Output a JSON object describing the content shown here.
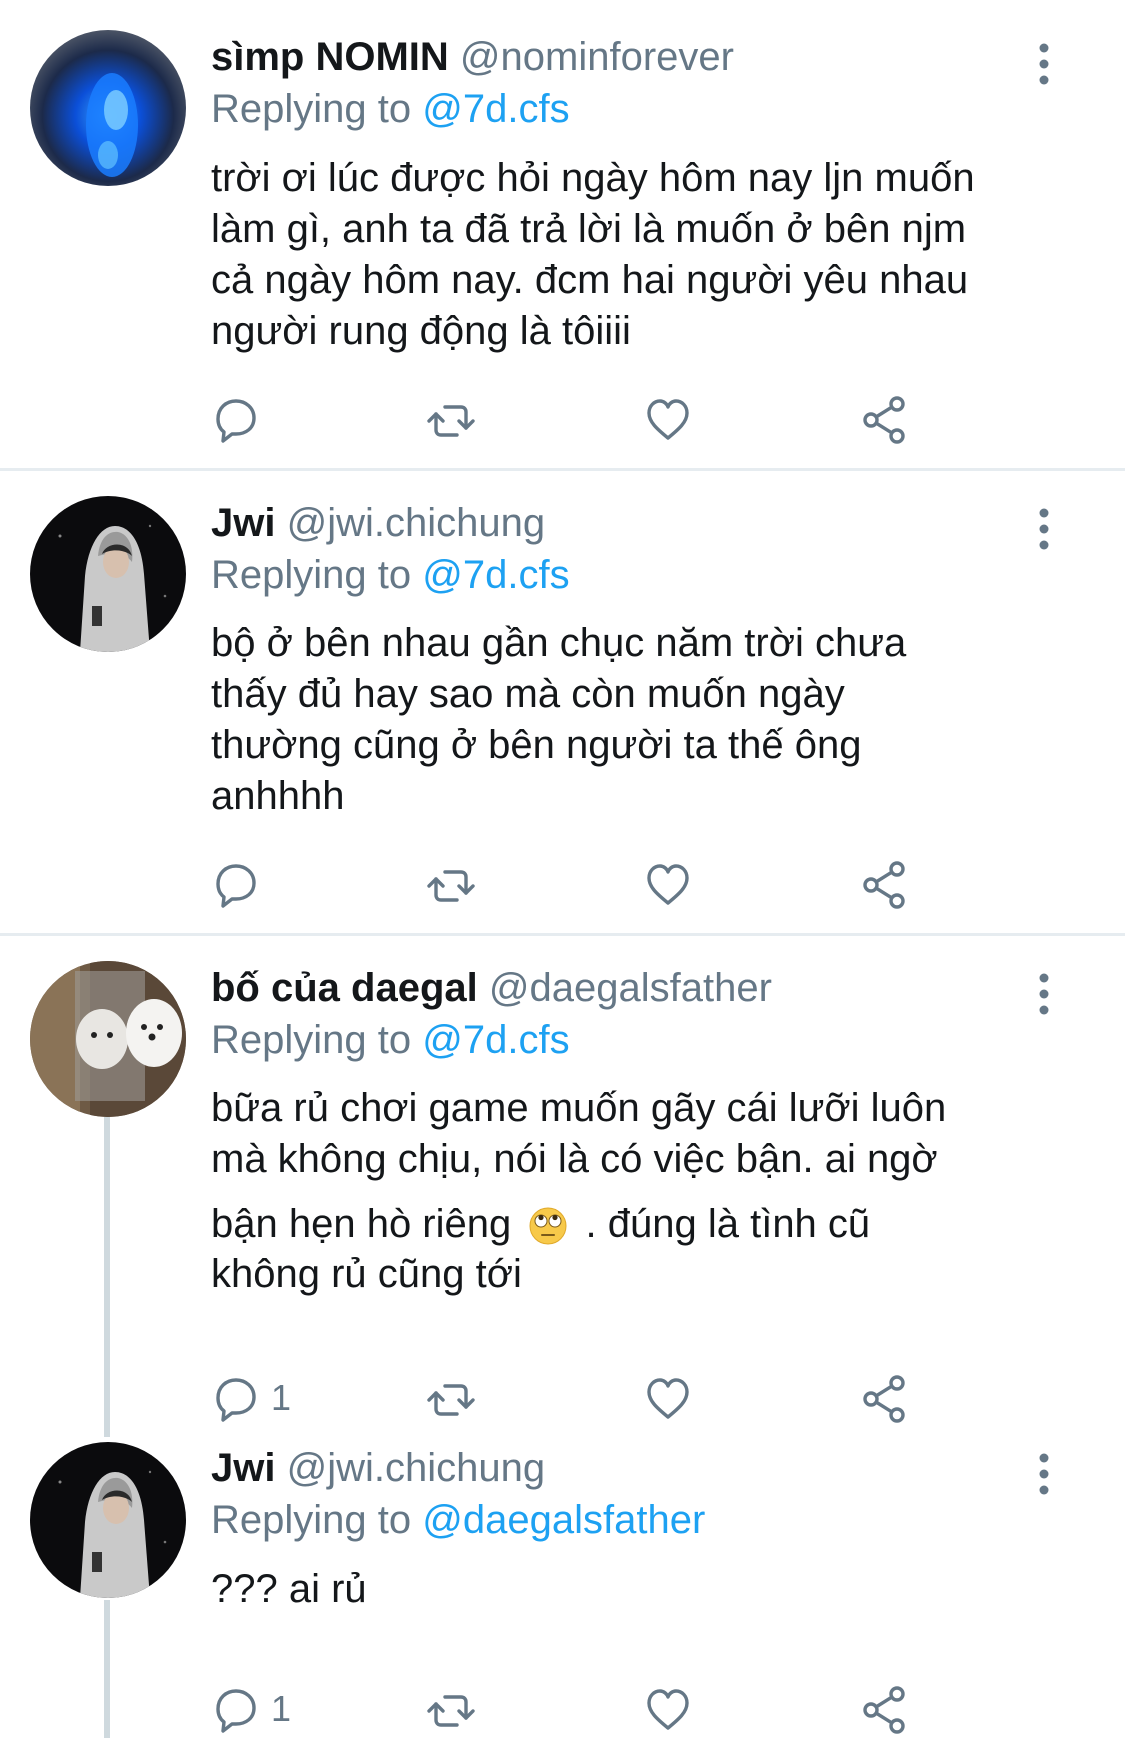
{
  "tweets": [
    {
      "name": "sìmp NOMIN",
      "handle": "@nominforever",
      "replying_prefix": "Replying to",
      "replying_to": "@7d.cfs",
      "lines": [
        "trời ơi lúc được hỏi ngày hôm nay ljn muốn",
        "làm gì, anh ta đã trả lời là muốn ở bên njm",
        "cả ngày hôm nay. đcm hai người yêu nhau",
        "người rung động là tôiiii"
      ],
      "reply_count": ""
    },
    {
      "name": "Jwi",
      "handle": "@jwi.chichung",
      "replying_prefix": "Replying to",
      "replying_to": "@7d.cfs",
      "lines": [
        "bộ ở bên nhau gần chục năm trời chưa",
        "thấy đủ hay sao mà còn muốn ngày",
        "thường cũng ở bên người ta thế ông",
        "anhhhh"
      ],
      "reply_count": ""
    },
    {
      "name": "bố của daegal",
      "handle": "@daegalsfather",
      "replying_prefix": "Replying to",
      "replying_to": "@7d.cfs",
      "lines": [
        "bữa rủ chơi game muốn gãy cái lưỡi luôn",
        "mà không chịu, nói là có việc bận. ai ngờ"
      ],
      "line3_before_emoji": "bận hẹn hò riêng",
      "line3_after_emoji": ". đúng là tình cũ",
      "line4": "không rủ cũng tới",
      "emoji": "face-with-rolling-eyes-emoji",
      "reply_count": "1"
    },
    {
      "name": "Jwi",
      "handle": "@jwi.chichung",
      "replying_prefix": "Replying to",
      "replying_to": "@daegalsfather",
      "lines": [
        "??? ai rủ"
      ],
      "reply_count": "1"
    }
  ],
  "icons": {
    "reply": "reply-icon",
    "retweet": "retweet-icon",
    "like": "like-icon",
    "share": "share-icon",
    "more": "more-options-icon"
  },
  "colors": {
    "text": "#14171a",
    "secondary": "#657786",
    "link": "#1da1f2",
    "divider": "#e6ecf0",
    "thread_line": "#cfd9de"
  }
}
